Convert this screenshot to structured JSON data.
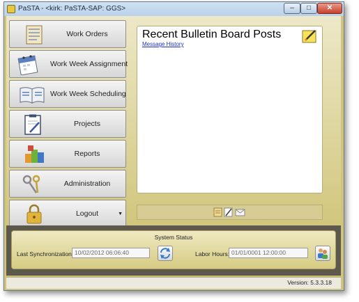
{
  "window": {
    "title": "PaSTA - <kirk: PaSTA-SAP: GGS>",
    "controls": {
      "minimize": "–",
      "maximize": "□",
      "close": "✕"
    }
  },
  "nav": {
    "items": [
      {
        "label": "Work Orders",
        "icon": "clipboard-list-icon"
      },
      {
        "label": "Work Week Assignment",
        "icon": "calendar-icon"
      },
      {
        "label": "Work Week Scheduling",
        "icon": "open-book-icon"
      },
      {
        "label": "Projects",
        "icon": "clipboard-pen-icon"
      },
      {
        "label": "Reports",
        "icon": "colored-blocks-icon"
      },
      {
        "label": "Administration",
        "icon": "keys-icon"
      },
      {
        "label": "Logout",
        "icon": "padlock-icon"
      }
    ]
  },
  "bulletin": {
    "title": "Recent Bulletin Board Posts",
    "link": "Message History",
    "icon": "note-pencil-icon"
  },
  "message_bar": {
    "icons": [
      "notes-icon",
      "paper-pen-icon",
      "envelope-icon"
    ]
  },
  "status": {
    "header": "System Status",
    "last_sync_label": "Last Synchronization:",
    "last_sync_value": "10/02/2012 06:06:40",
    "labor_hours_label": "Labor Hours:",
    "labor_hours_value": "01/01/0001 12:00:00",
    "sync_button_icon": "refresh-icon",
    "users_button_icon": "users-icon"
  },
  "footer": {
    "version": "Version: 5.3.3.18"
  },
  "colors": {
    "window_background": "#cfc47c",
    "dark_band": "#5c584c",
    "link": "#1a32c8"
  }
}
